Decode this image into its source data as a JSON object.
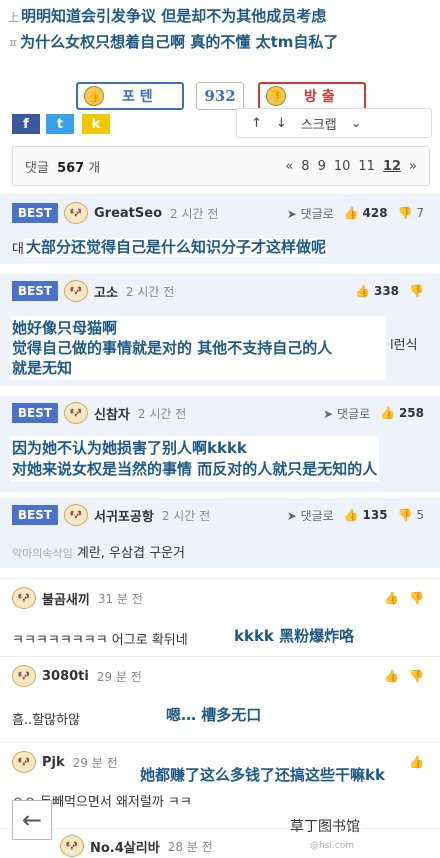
{
  "captions": {
    "line1_mark": "上",
    "line1": "明明知道会引发争议 但是却不为其他成员考虑",
    "line2_mark": "ㅍ",
    "line2": "为什么女权只想着自己啊 真的不懂 太tm自私了"
  },
  "vote": {
    "up_label": "포 텐",
    "count": "932",
    "down_label": "방 출"
  },
  "share": {
    "facebook": "f",
    "twitter": "t",
    "kakao": "k",
    "scrap_up": "↑",
    "scrap_down": "↓",
    "scrap_label": "스크랩",
    "more": "⌄"
  },
  "pager": {
    "count_prefix": "댓글",
    "count": "567",
    "count_suffix": "개",
    "first": "«",
    "pages": [
      "8",
      "9",
      "10",
      "11"
    ],
    "current": "12",
    "next": "»"
  },
  "best_label": "BEST",
  "comments": [
    {
      "nick": "GreatSeo",
      "time": "2 시간 전",
      "reply": "댓글로",
      "likes": "428",
      "dislikes": "7",
      "body_prefix": "대",
      "overlay": "大部分还觉得自己是什么知识分子才这样做呢"
    },
    {
      "nick": "고소",
      "time": "2 시간 전",
      "reply": "댓글로",
      "likes": "338",
      "dislikes": "",
      "body_suffix": "l런식",
      "overlay_lines": [
        "她好像只母猫啊",
        "觉得自己做的事情就是对的 其他不支持自己的人",
        "就是无知"
      ]
    },
    {
      "nick": "신참자",
      "time": "2 시간 전",
      "reply": "댓글로",
      "likes": "258",
      "dislikes": "",
      "overlay_lines": [
        "因为她不认为她损害了别人啊kkkk",
        "对她来说女权是当然的事情 而反对的人就只是无知的人"
      ]
    },
    {
      "nick": "서귀포공항",
      "time": "2 시간 전",
      "reply": "댓글로",
      "likes": "135",
      "dislikes": "5",
      "body_prefix": "악마의속삭임",
      "body": "계란, 우삼겹 구운거"
    }
  ],
  "plain_comments": [
    {
      "nick": "불곰새끼",
      "time": "31 분 전",
      "body": "ㅋㅋㅋㅋㅋㅋㅋㅋ 어그로 확뒤네",
      "overlay": "kkkk 黑粉爆炸咯"
    },
    {
      "nick": "3080ti",
      "time": "29 분 전",
      "body": "흠..할많하않",
      "overlay": "嗯… 槽多无口"
    },
    {
      "nick": "Pjk",
      "time": "29 분 전",
      "body": "ㅇㅇ 돈빼먹으면서 왜저럴까 ㅋㅋ",
      "overlay": "她都赚了这么多钱了还搞这些干嘛kk"
    },
    {
      "nick": "No.4살리바",
      "time": "28 분 전"
    }
  ],
  "watermark": {
    "text": "草丁图书馆",
    "sub": "@hsi.com"
  }
}
